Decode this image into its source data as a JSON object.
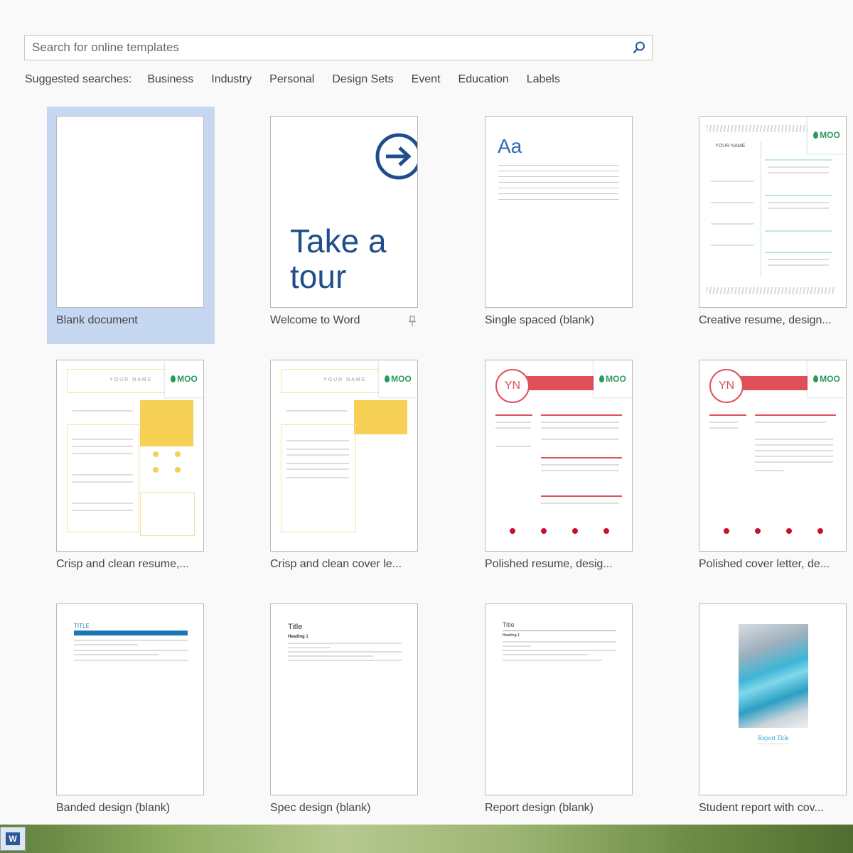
{
  "search": {
    "placeholder": "Search for online templates"
  },
  "suggested": {
    "label": "Suggested searches:",
    "links": [
      "Business",
      "Industry",
      "Personal",
      "Design Sets",
      "Event",
      "Education",
      "Labels"
    ]
  },
  "templates": [
    {
      "caption": "Blank document"
    },
    {
      "caption": "Welcome to Word",
      "thumb_line1": "Take a",
      "thumb_line2": "tour"
    },
    {
      "caption": "Single spaced (blank)",
      "thumb_text": "Aa"
    },
    {
      "caption": "Creative resume, design...",
      "thumb_name": "YOUR NAME",
      "badge": "MOO"
    },
    {
      "caption": "Crisp and clean resume,...",
      "thumb_name": "YOUR NAME",
      "badge": "MOO"
    },
    {
      "caption": "Crisp and clean cover le...",
      "thumb_name": "YOUR NAME",
      "badge": "MOO"
    },
    {
      "caption": "Polished resume, desig...",
      "thumb_initials": "YN",
      "badge": "MOO"
    },
    {
      "caption": "Polished cover letter, de...",
      "thumb_initials": "YN",
      "badge": "MOO"
    },
    {
      "caption": "Banded design (blank)",
      "thumb_title": "TITLE"
    },
    {
      "caption": "Spec design (blank)",
      "thumb_title": "Title",
      "thumb_heading": "Heading 1"
    },
    {
      "caption": "Report design (blank)",
      "thumb_title": "Title",
      "thumb_heading": "Heading 1"
    },
    {
      "caption": "Student report with cov...",
      "thumb_title": "Report Title"
    }
  ],
  "colors": {
    "accent_blue": "#1f4e8c",
    "selected_tile": "#c6d7f2",
    "moo_green": "#2a9a5a",
    "polished_red": "#e0505a",
    "crisp_yellow": "#f6cf55",
    "banded_blue": "#1b78b8",
    "student_teal": "#2fa6c8"
  },
  "taskbar": {
    "app_icon": "word-icon",
    "app_letter": "W"
  }
}
